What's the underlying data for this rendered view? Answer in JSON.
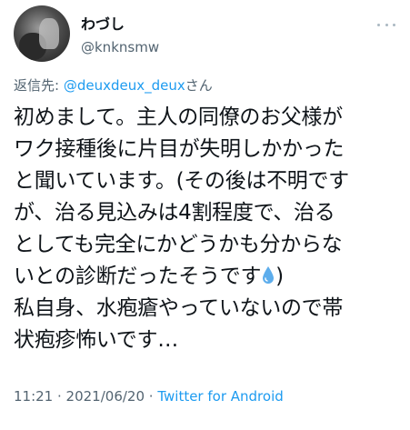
{
  "author": {
    "display_name": "わづし",
    "username": "@knknsmw"
  },
  "reply": {
    "prefix": "返信先: ",
    "handle": "@deuxdeux_deux",
    "suffix": "さん"
  },
  "tweet": {
    "lines": [
      "初めまして。主人の同僚のお父様が",
      "ワク接種後に片目が失明しかかった",
      "と聞いています。(その後は不明です",
      "が、治る見込みは4割程度で、治る",
      "としても完全にかどうかも分からな",
      "いとの診断だったそうです",
      ")",
      "私自身、水疱瘡やっていないので帯",
      "状疱疹怖いです…"
    ],
    "emoji_icon": "droplet-icon",
    "emoji_color": "#5dadec"
  },
  "meta": {
    "time": "11:21",
    "separator1": " · ",
    "date": "2021/06/20",
    "separator2": " · ",
    "source": "Twitter for Android"
  },
  "colors": {
    "link": "#1d9bf0",
    "secondary_text": "#536471",
    "primary_text": "#0f1419"
  }
}
